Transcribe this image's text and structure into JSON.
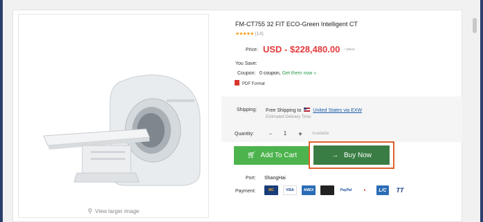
{
  "product": {
    "title": "FM-CT755 32 FIT ECO-Green Intelligent CT",
    "stars": "★★★★★",
    "review_count": "(14)",
    "price_label": "Price:",
    "price": "USD - $228,480.00",
    "price_unit": "/ piece",
    "you_save_label": "You Save:",
    "coupon_label": "Coupon:",
    "coupon_text": "0 coupon,",
    "coupon_link": "Get them now »",
    "pdf_label": "PDF Format"
  },
  "shipping": {
    "label": "Shipping:",
    "text_prefix": "Free Shipping to",
    "destination": "United States via EXW",
    "estimated": "Estimated Delivery Time:"
  },
  "quantity": {
    "label": "Quantity:",
    "minus": "−",
    "value": "1",
    "plus": "+",
    "availability": "Available"
  },
  "actions": {
    "add_to_cart": "Add To Cart",
    "buy_now": "Buy Now"
  },
  "port": {
    "label": "Port:",
    "value": "ShangHai"
  },
  "payment": {
    "label": "Payment:",
    "methods": [
      "MC",
      "VISA",
      "AMEX",
      "",
      "PayPal",
      "",
      "L/C",
      "TT"
    ]
  },
  "image": {
    "view_larger": "View larger image"
  },
  "colors": {
    "price": "#e4393c",
    "add_to_cart": "#4db34d",
    "buy_now": "#3a7d44",
    "highlight": "#e0602a",
    "frame": "#2b3f6b"
  }
}
